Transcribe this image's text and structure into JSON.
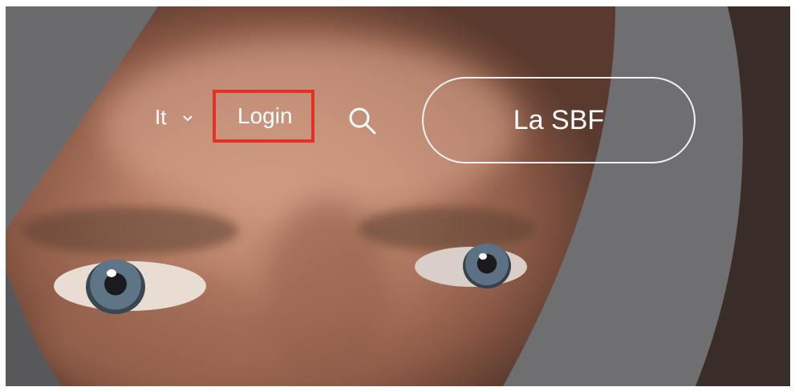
{
  "header": {
    "language": {
      "label": "It",
      "icon": "chevron-down-icon"
    },
    "login_label": "Login",
    "search_icon": "search-icon",
    "cta_label": "La SBF"
  },
  "colors": {
    "highlight_border": "#e53027",
    "text": "#ffffff",
    "blade": "#6f6f71"
  }
}
